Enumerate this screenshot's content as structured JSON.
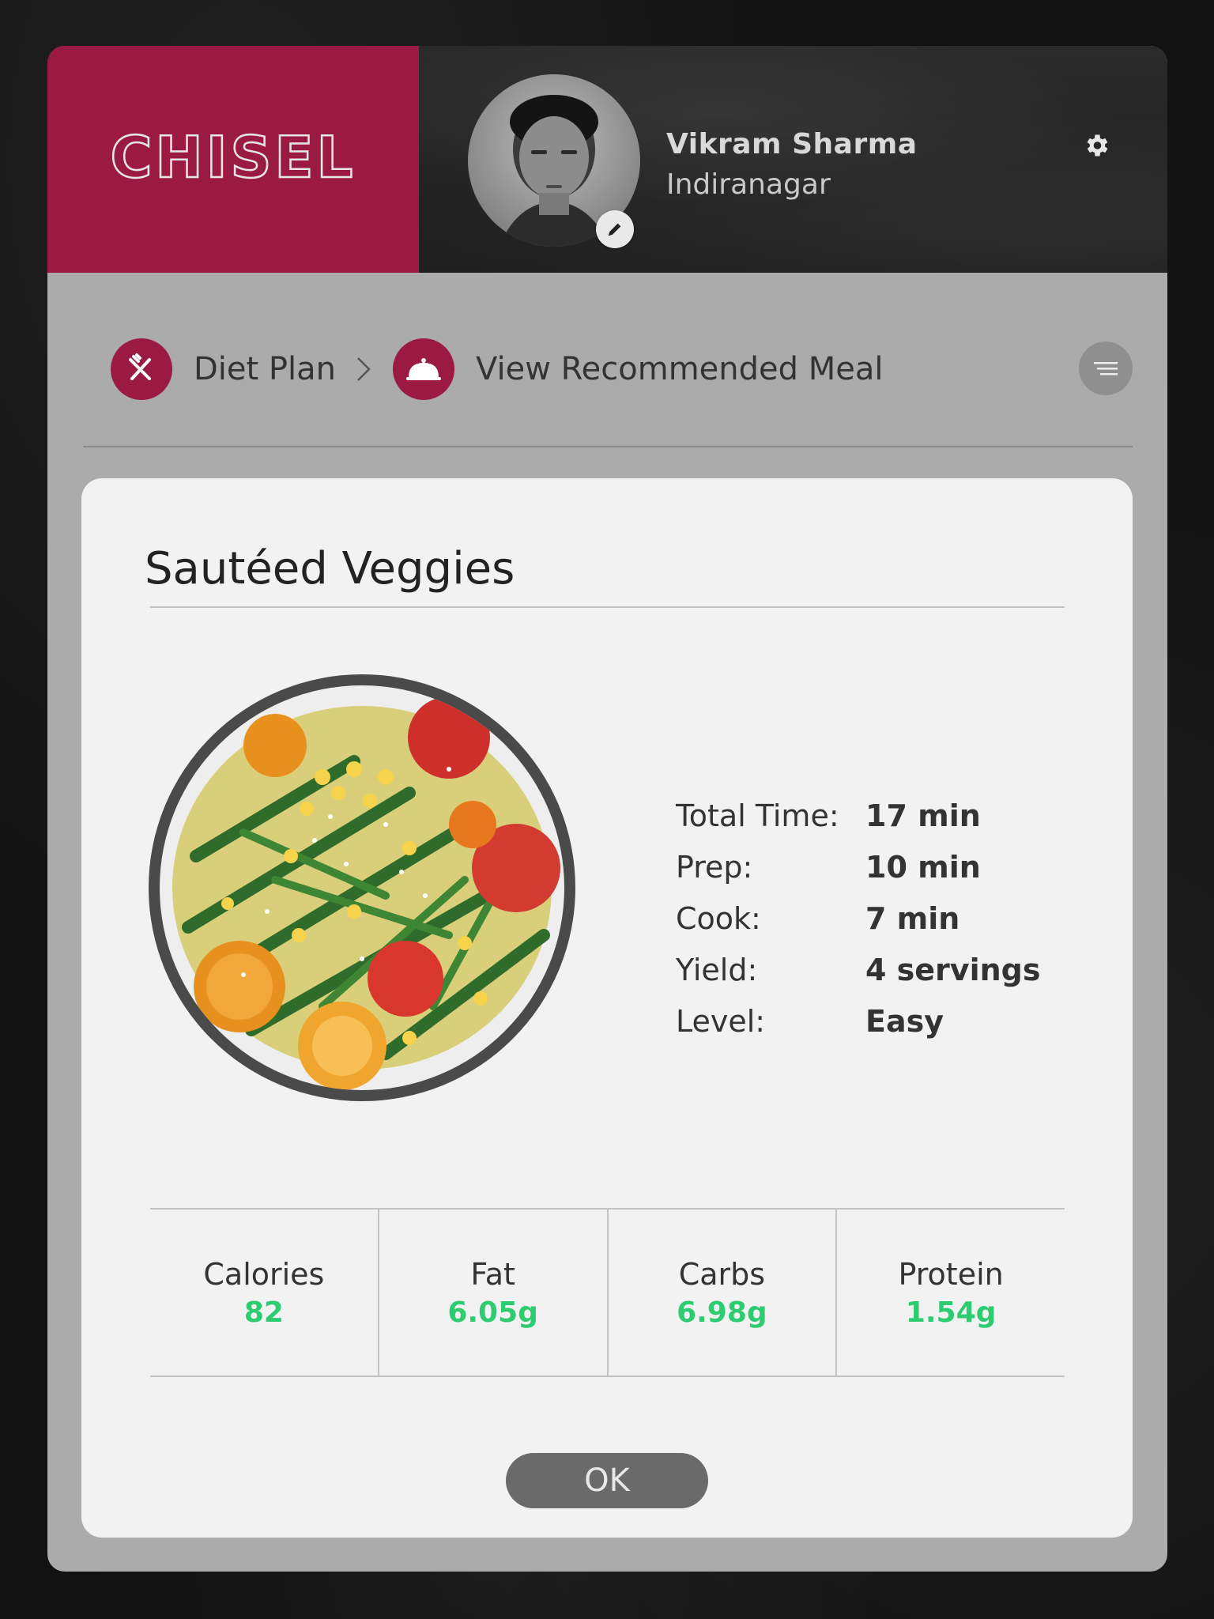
{
  "brand": {
    "logo_text": "CHISEL",
    "accent_color": "#9a1a43"
  },
  "user": {
    "name": "Vikram Sharma",
    "location": "Indiranagar",
    "avatar_icon": "user-avatar",
    "edit_icon": "pencil-icon"
  },
  "header": {
    "settings_icon": "gear-icon"
  },
  "breadcrumb": {
    "items": [
      {
        "label": "Diet Plan",
        "icon": "fork-knife-icon"
      },
      {
        "label": "View Recommended Meal",
        "icon": "meal-cloche-icon"
      }
    ],
    "separator_icon": "chevron-right-icon",
    "menu_icon": "menu-lines-icon"
  },
  "meal": {
    "title": "Sautéed Veggies",
    "details": [
      {
        "label": "Total Time:",
        "value": "17 min"
      },
      {
        "label": "Prep:",
        "value": "10 min"
      },
      {
        "label": "Cook:",
        "value": "7 min"
      },
      {
        "label": "Yield:",
        "value": "4 servings"
      },
      {
        "label": "Level:",
        "value": "Easy"
      }
    ],
    "nutrition": [
      {
        "label": "Calories",
        "value": "82"
      },
      {
        "label": "Fat",
        "value": "6.05g"
      },
      {
        "label": "Carbs",
        "value": "6.98g"
      },
      {
        "label": "Protein",
        "value": "1.54g"
      }
    ],
    "nutrition_value_color": "#2ecc71"
  },
  "actions": {
    "ok_label": "OK"
  }
}
